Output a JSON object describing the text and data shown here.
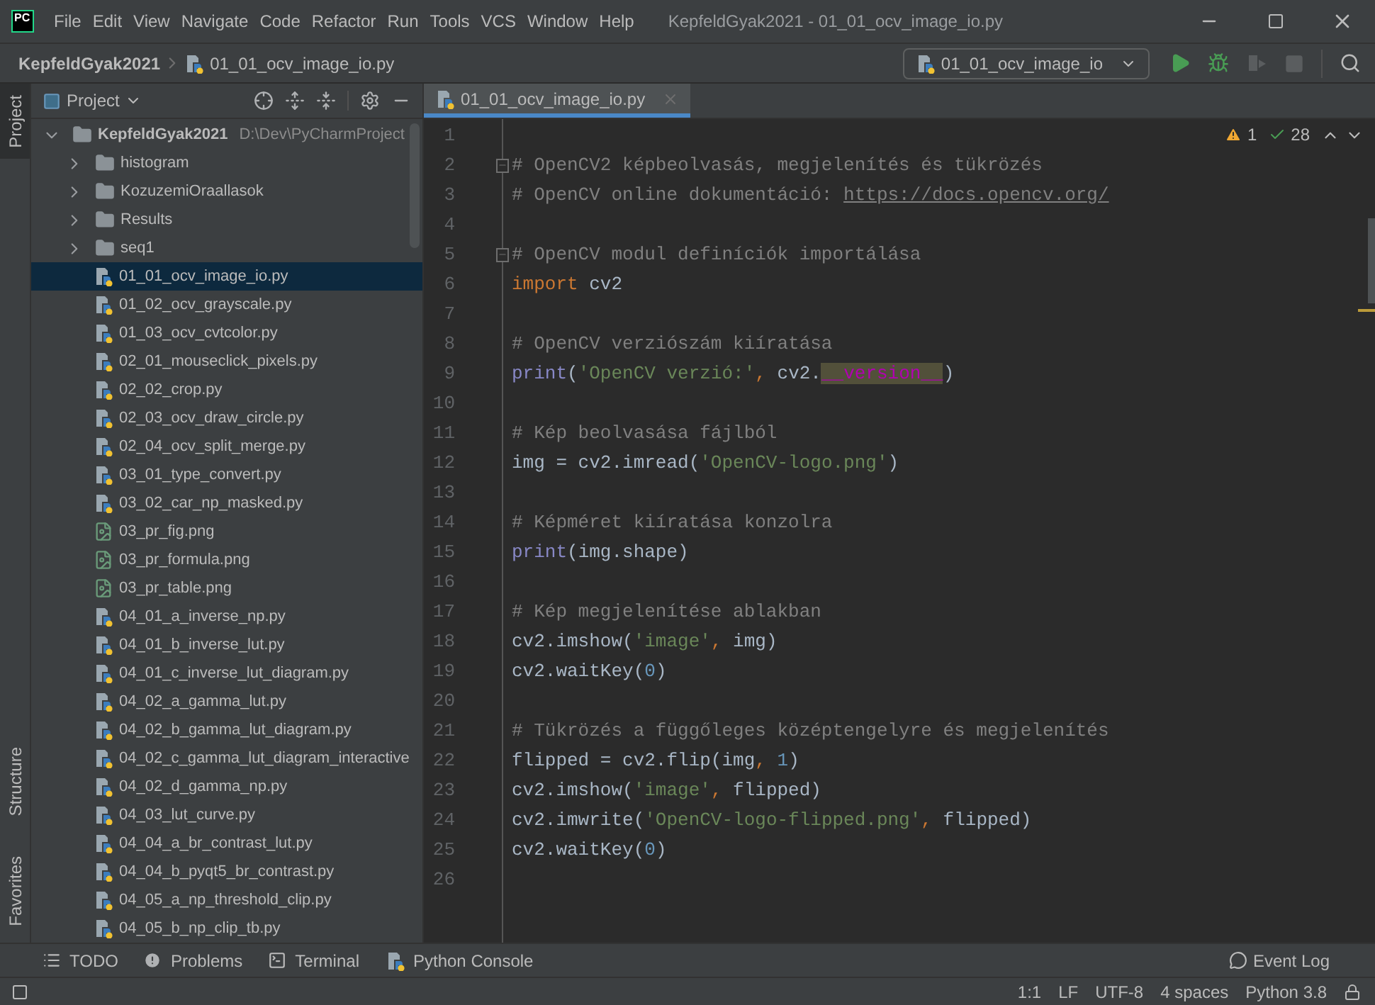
{
  "window": {
    "logo": "PC",
    "title": "KepfeldGyak2021 - 01_01_ocv_image_io.py"
  },
  "menu": [
    "File",
    "Edit",
    "View",
    "Navigate",
    "Code",
    "Refactor",
    "Run",
    "Tools",
    "VCS",
    "Window",
    "Help"
  ],
  "breadcrumb": [
    "KepfeldGyak2021",
    "01_01_ocv_image_io.py"
  ],
  "run_config": "01_01_ocv_image_io",
  "run_buttons": [
    {
      "kind": "run",
      "disabled": false
    },
    {
      "kind": "debug",
      "disabled": false
    },
    {
      "kind": "coverage",
      "disabled": true
    },
    {
      "kind": "stop",
      "disabled": true
    }
  ],
  "left_stripe": [
    {
      "label": "Project",
      "selected": true
    },
    {
      "label": "Structure",
      "selected": false
    },
    {
      "label": "Favorites",
      "selected": false
    }
  ],
  "project_panel": {
    "title": "Project",
    "tree": {
      "name": "KepfeldGyak2021",
      "path": "D:\\Dev\\PyCharmProject",
      "expanded": true,
      "children": [
        {
          "name": "histogram",
          "kind": "folder",
          "expanded": false,
          "selected": false
        },
        {
          "name": "KozuzemiOraallasok",
          "kind": "folder",
          "expanded": false,
          "selected": false
        },
        {
          "name": "Results",
          "kind": "folder",
          "expanded": false,
          "selected": false
        },
        {
          "name": "seq1",
          "kind": "folder",
          "expanded": false,
          "selected": false
        },
        {
          "name": "01_01_ocv_image_io.py",
          "kind": "py",
          "selected": true
        },
        {
          "name": "01_02_ocv_grayscale.py",
          "kind": "py",
          "selected": false
        },
        {
          "name": "01_03_ocv_cvtcolor.py",
          "kind": "py",
          "selected": false
        },
        {
          "name": "02_01_mouseclick_pixels.py",
          "kind": "py",
          "selected": false
        },
        {
          "name": "02_02_crop.py",
          "kind": "py",
          "selected": false
        },
        {
          "name": "02_03_ocv_draw_circle.py",
          "kind": "py",
          "selected": false
        },
        {
          "name": "02_04_ocv_split_merge.py",
          "kind": "py",
          "selected": false
        },
        {
          "name": "03_01_type_convert.py",
          "kind": "py",
          "selected": false
        },
        {
          "name": "03_02_car_np_masked.py",
          "kind": "py",
          "selected": false
        },
        {
          "name": "03_pr_fig.png",
          "kind": "png",
          "selected": false
        },
        {
          "name": "03_pr_formula.png",
          "kind": "png",
          "selected": false
        },
        {
          "name": "03_pr_table.png",
          "kind": "png",
          "selected": false
        },
        {
          "name": "04_01_a_inverse_np.py",
          "kind": "py",
          "selected": false
        },
        {
          "name": "04_01_b_inverse_lut.py",
          "kind": "py",
          "selected": false
        },
        {
          "name": "04_01_c_inverse_lut_diagram.py",
          "kind": "py",
          "selected": false
        },
        {
          "name": "04_02_a_gamma_lut.py",
          "kind": "py",
          "selected": false
        },
        {
          "name": "04_02_b_gamma_lut_diagram.py",
          "kind": "py",
          "selected": false
        },
        {
          "name": "04_02_c_gamma_lut_diagram_interactive",
          "kind": "py",
          "selected": false
        },
        {
          "name": "04_02_d_gamma_np.py",
          "kind": "py",
          "selected": false
        },
        {
          "name": "04_03_lut_curve.py",
          "kind": "py",
          "selected": false
        },
        {
          "name": "04_04_a_br_contrast_lut.py",
          "kind": "py",
          "selected": false
        },
        {
          "name": "04_04_b_pyqt5_br_contrast.py",
          "kind": "py",
          "selected": false
        },
        {
          "name": "04_05_a_np_threshold_clip.py",
          "kind": "py",
          "selected": false
        },
        {
          "name": "04_05_b_np_clip_tb.py",
          "kind": "py",
          "selected": false
        }
      ]
    }
  },
  "editor": {
    "tabs": [
      {
        "label": "01_01_ocv_image_io.py",
        "selected": true
      }
    ],
    "inspections": {
      "warnings": "1",
      "typos": "28"
    },
    "lines": [
      {
        "n": "1",
        "fold": false
      },
      {
        "n": "2",
        "fold": true,
        "tokens": [
          {
            "kind": "comment",
            "text": "# OpenCV2 képbeolvasás, megjelenítés és tükrözés"
          }
        ]
      },
      {
        "n": "3",
        "fold": false,
        "tokens": [
          {
            "kind": "comment",
            "text": "# OpenCV online dokumentáció: "
          },
          {
            "kind": "link",
            "text": "https://docs.opencv.org/"
          }
        ]
      },
      {
        "n": "4",
        "fold": false
      },
      {
        "n": "5",
        "fold": true,
        "tokens": [
          {
            "kind": "comment",
            "text": "# OpenCV modul definíciók importálása"
          }
        ]
      },
      {
        "n": "6",
        "fold": false,
        "tokens": [
          {
            "kind": "keyword",
            "text": "import"
          },
          {
            "kind": "plain",
            "text": " cv2"
          }
        ]
      },
      {
        "n": "7",
        "fold": false
      },
      {
        "n": "8",
        "fold": false,
        "tokens": [
          {
            "kind": "comment",
            "text": "# OpenCV verziószám kiíratása"
          }
        ]
      },
      {
        "n": "9",
        "fold": false,
        "tokens": [
          {
            "kind": "builtin",
            "text": "print"
          },
          {
            "kind": "plain",
            "text": "("
          },
          {
            "kind": "string",
            "text": "'OpenCV verzió:'"
          },
          {
            "kind": "keyword",
            "text": ","
          },
          {
            "kind": "plain",
            "text": " cv2."
          },
          {
            "kind": "dunder",
            "text": "__version__"
          },
          {
            "kind": "plain",
            "text": ")"
          }
        ]
      },
      {
        "n": "10",
        "fold": false
      },
      {
        "n": "11",
        "fold": false,
        "tokens": [
          {
            "kind": "comment",
            "text": "# Kép beolvasása fájlból"
          }
        ]
      },
      {
        "n": "12",
        "fold": false,
        "tokens": [
          {
            "kind": "plain",
            "text": "img = cv2.imread("
          },
          {
            "kind": "string",
            "text": "'OpenCV-logo.png'"
          },
          {
            "kind": "plain",
            "text": ")"
          }
        ]
      },
      {
        "n": "13",
        "fold": false
      },
      {
        "n": "14",
        "fold": false,
        "tokens": [
          {
            "kind": "comment",
            "text": "# Képméret kiíratása konzolra"
          }
        ]
      },
      {
        "n": "15",
        "fold": false,
        "tokens": [
          {
            "kind": "builtin",
            "text": "print"
          },
          {
            "kind": "plain",
            "text": "(img.shape)"
          }
        ]
      },
      {
        "n": "16",
        "fold": false
      },
      {
        "n": "17",
        "fold": false,
        "tokens": [
          {
            "kind": "comment",
            "text": "# Kép megjelenítése ablakban"
          }
        ]
      },
      {
        "n": "18",
        "fold": false,
        "tokens": [
          {
            "kind": "plain",
            "text": "cv2.imshow("
          },
          {
            "kind": "string",
            "text": "'image'"
          },
          {
            "kind": "keyword",
            "text": ","
          },
          {
            "kind": "plain",
            "text": " img)"
          }
        ]
      },
      {
        "n": "19",
        "fold": false,
        "tokens": [
          {
            "kind": "plain",
            "text": "cv2.waitKey("
          },
          {
            "kind": "number",
            "text": "0"
          },
          {
            "kind": "plain",
            "text": ")"
          }
        ]
      },
      {
        "n": "20",
        "fold": false
      },
      {
        "n": "21",
        "fold": false,
        "tokens": [
          {
            "kind": "comment",
            "text": "# Tükrözés a függőleges középtengelyre és megjelenítés"
          }
        ]
      },
      {
        "n": "22",
        "fold": false,
        "tokens": [
          {
            "kind": "plain",
            "text": "flipped = cv2.flip(img"
          },
          {
            "kind": "keyword",
            "text": ","
          },
          {
            "kind": "number",
            "text": " 1"
          },
          {
            "kind": "plain",
            "text": ")"
          }
        ]
      },
      {
        "n": "23",
        "fold": false,
        "tokens": [
          {
            "kind": "plain",
            "text": "cv2.imshow("
          },
          {
            "kind": "string",
            "text": "'image'"
          },
          {
            "kind": "keyword",
            "text": ","
          },
          {
            "kind": "plain",
            "text": " flipped)"
          }
        ]
      },
      {
        "n": "24",
        "fold": false,
        "tokens": [
          {
            "kind": "plain",
            "text": "cv2.imwrite("
          },
          {
            "kind": "string",
            "text": "'OpenCV-logo-flipped.png'"
          },
          {
            "kind": "keyword",
            "text": ","
          },
          {
            "kind": "plain",
            "text": " flipped)"
          }
        ]
      },
      {
        "n": "25",
        "fold": false,
        "tokens": [
          {
            "kind": "plain",
            "text": "cv2.waitKey("
          },
          {
            "kind": "number",
            "text": "0"
          },
          {
            "kind": "plain",
            "text": ")"
          }
        ]
      },
      {
        "n": "26",
        "fold": false
      }
    ]
  },
  "tool_windows": [
    {
      "kind": "todo",
      "label": "TODO"
    },
    {
      "kind": "problems",
      "label": "Problems"
    },
    {
      "kind": "terminal",
      "label": "Terminal"
    },
    {
      "kind": "console",
      "label": "Python Console"
    }
  ],
  "event_log": "Event Log",
  "status_bar": [
    "1:1",
    "LF",
    "UTF-8",
    "4 spaces",
    "Python 3.8"
  ]
}
